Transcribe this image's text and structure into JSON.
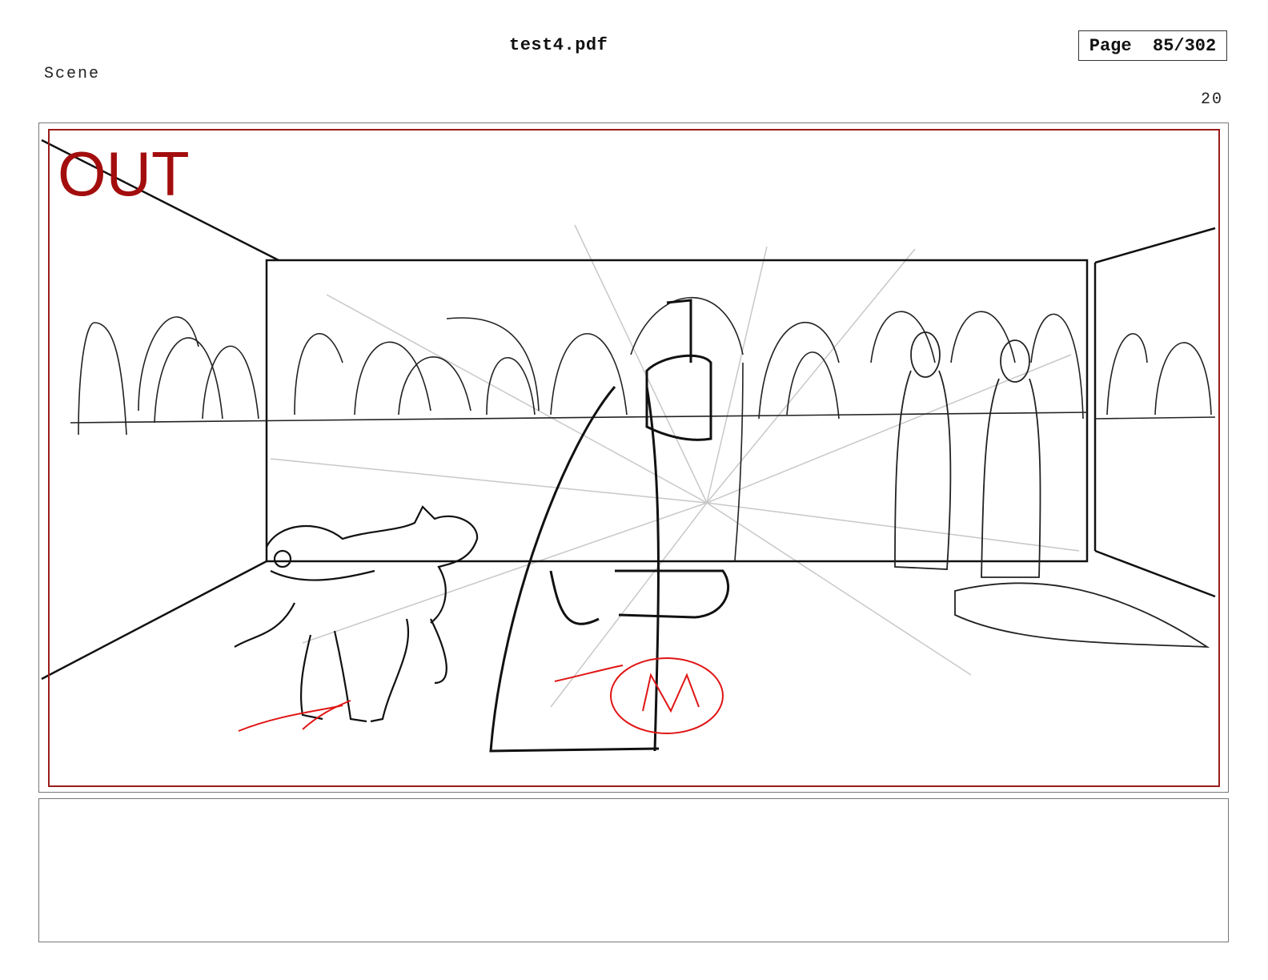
{
  "header": {
    "doc_title": "test4.pdf",
    "page_indicator": "Page  85/302"
  },
  "scene": {
    "label": "Scene",
    "panel_number": "20"
  },
  "panel": {
    "overlay_text": "OUT",
    "overlay_color": "#a30d0d",
    "safe_area_color": "#9b1c1c",
    "notes_text": ""
  }
}
